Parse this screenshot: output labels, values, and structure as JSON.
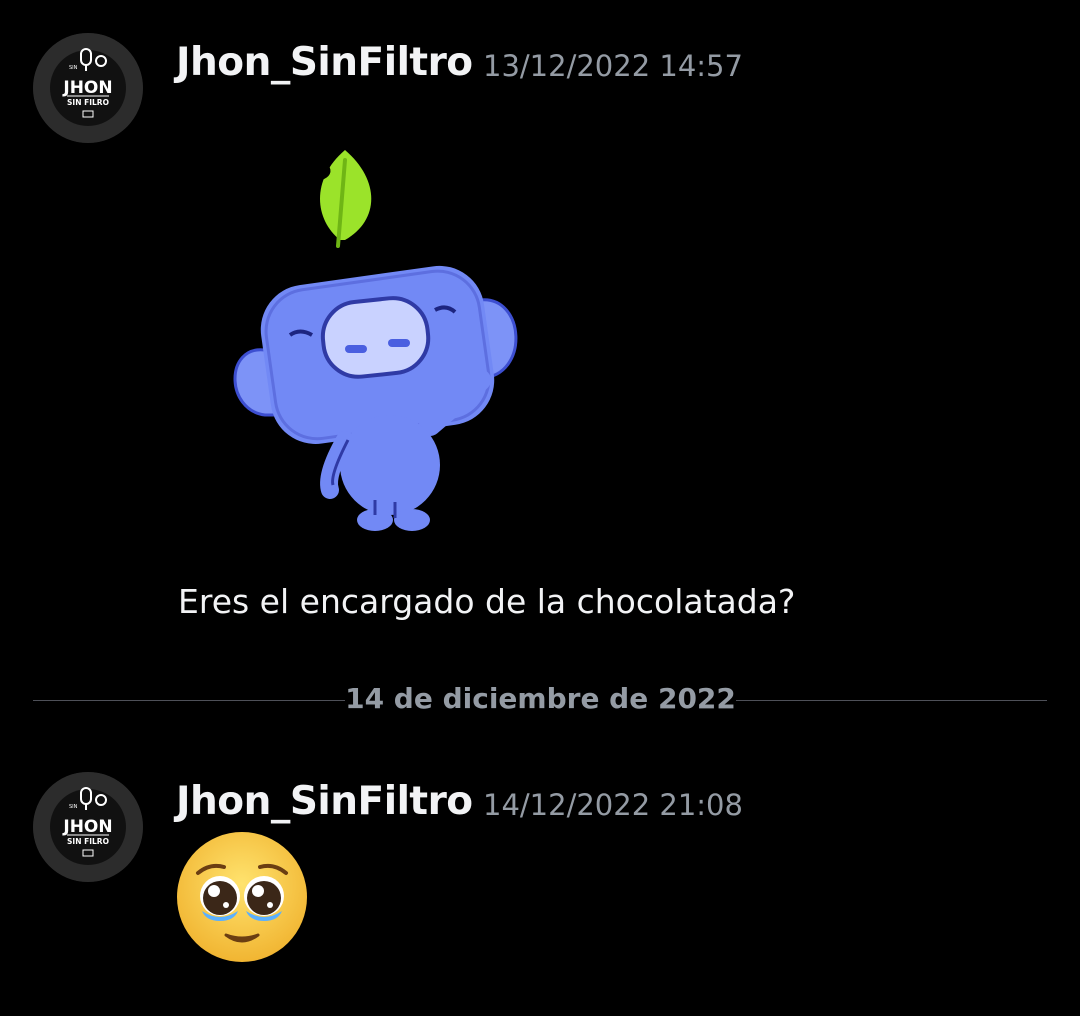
{
  "messages": [
    {
      "username": "Jhon_SinFiltro",
      "timestamp": "13/12/2022 14:57",
      "sticker": "wumpus-waving-sticker",
      "text": "Eres el encargado de la chocolatada?"
    },
    {
      "username": "Jhon_SinFiltro",
      "timestamp": "14/12/2022 21:08",
      "emoji": "pleading-face-emoji"
    }
  ],
  "date_divider": "14 de diciembre de 2022",
  "avatar_logo": {
    "top_text": "SIN",
    "main_text": "JHON",
    "sub_text": "SIN FILRO"
  },
  "colors": {
    "background": "#000000",
    "username": "#f2f3f5",
    "timestamp": "#949ba4",
    "divider": "#4e5058",
    "wumpus_blue": "#7289f5",
    "leaf_green": "#9be32a",
    "emoji_yellow": "#f8c53a"
  }
}
